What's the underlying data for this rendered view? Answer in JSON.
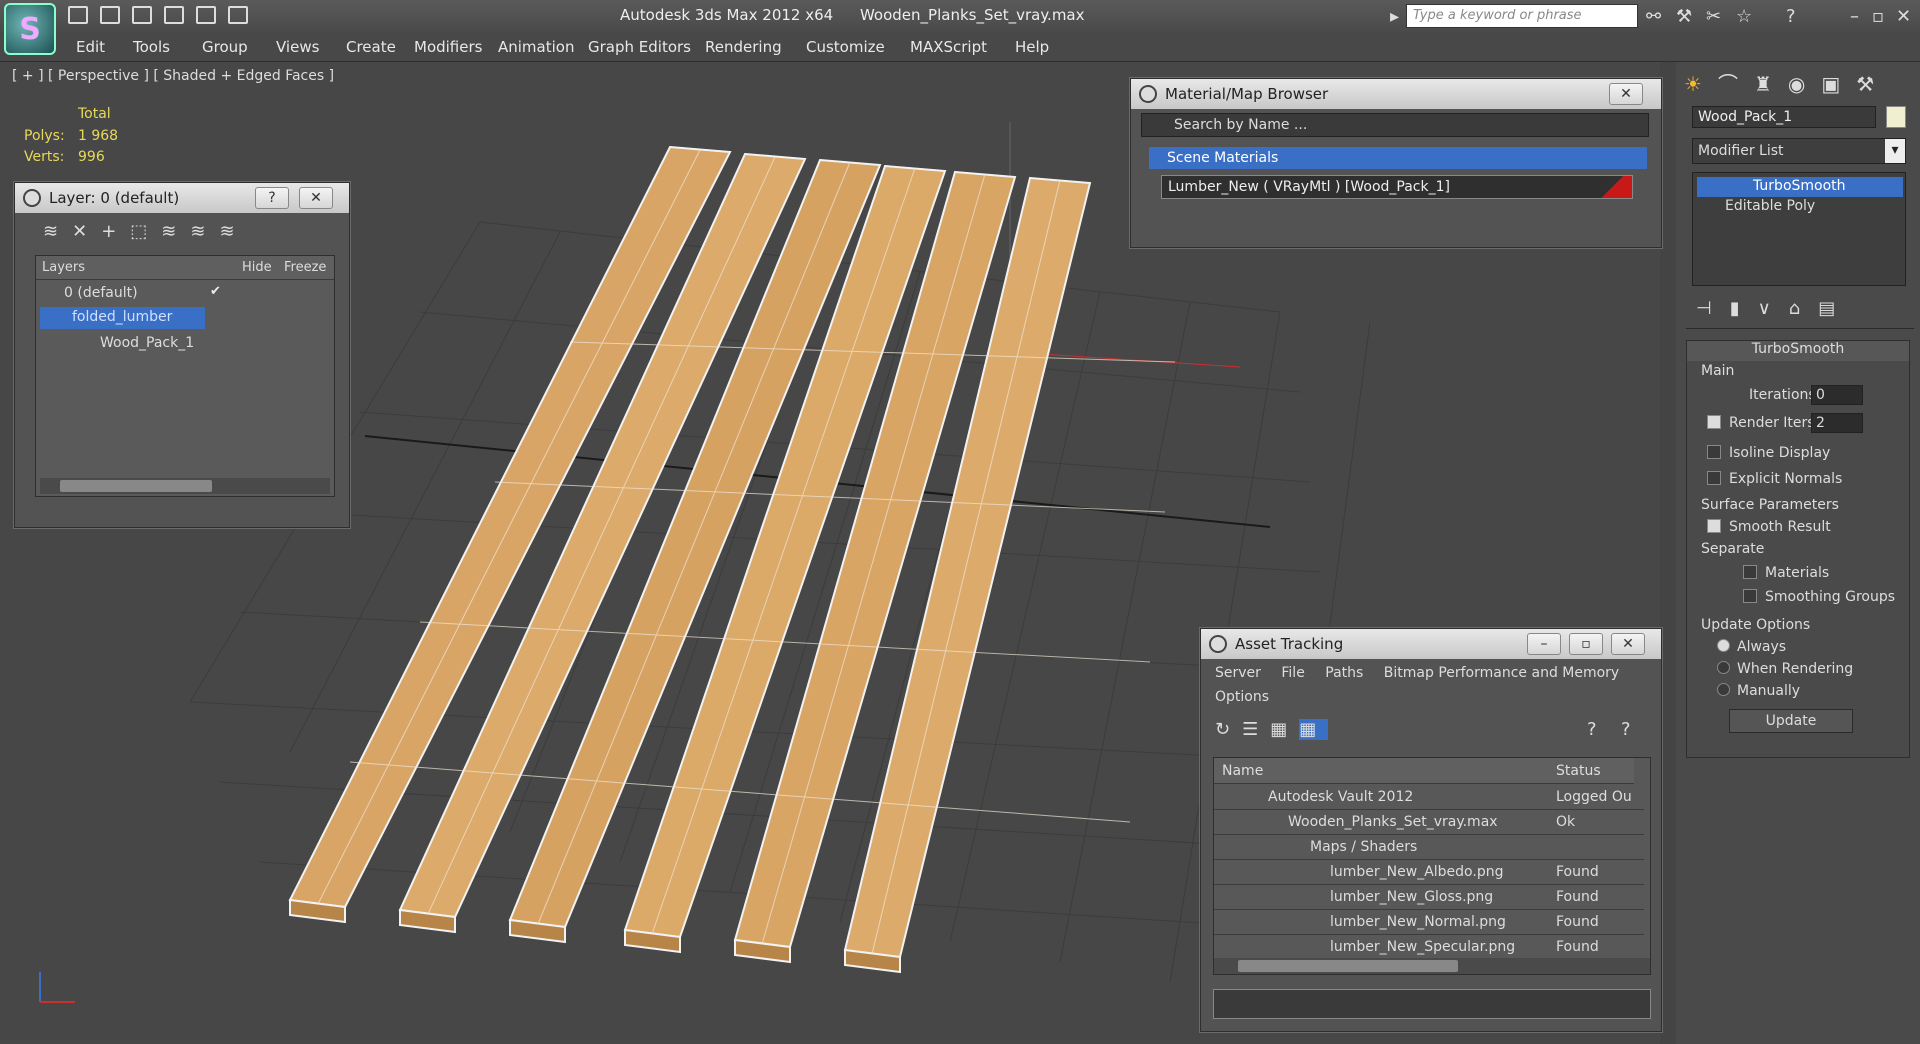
{
  "window": {
    "app_title": "Autodesk 3ds Max  2012 x64",
    "file_title": "Wooden_Planks_Set_vray.max",
    "search_placeholder": "Type a keyword or phrase"
  },
  "menu": [
    "Edit",
    "Tools",
    "Group",
    "Views",
    "Create",
    "Modifiers",
    "Animation",
    "Graph Editors",
    "Rendering",
    "Customize",
    "MAXScript",
    "Help"
  ],
  "viewport": {
    "label": "[ + ] [ Perspective ] [ Shaded + Edged Faces ]",
    "stats": {
      "total_label": "Total",
      "polys_label": "Polys:",
      "polys_value": "1 968",
      "verts_label": "Verts:",
      "verts_value": "996"
    }
  },
  "layer_panel": {
    "title": "Layer: 0 (default)",
    "help": "?",
    "close": "✕",
    "columns": {
      "layers": "Layers",
      "hide": "Hide",
      "freeze": "Freeze"
    },
    "rows": [
      "0 (default)",
      "folded_lumber",
      "Wood_Pack_1"
    ]
  },
  "material_browser": {
    "title": "Material/Map Browser",
    "search": "Search by Name ...",
    "section": "Scene Materials",
    "item": "Lumber_New  ( VRayMtl )  [Wood_Pack_1]"
  },
  "command_panel": {
    "object_name": "Wood_Pack_1",
    "modifier_list": "Modifier List",
    "stack": [
      "TurboSmooth",
      "Editable Poly"
    ],
    "rollout_title": "TurboSmooth",
    "main_group": "Main",
    "iterations_label": "Iterations:",
    "iterations_value": "0",
    "render_iters_label": "Render Iters:",
    "render_iters_value": "2",
    "isoline": "Isoline Display",
    "explicit_normals": "Explicit Normals",
    "surface_group": "Surface Parameters",
    "smooth_result": "Smooth Result",
    "separate": "Separate",
    "materials": "Materials",
    "smoothing_groups": "Smoothing Groups",
    "update_group": "Update Options",
    "always": "Always",
    "when_rendering": "When Rendering",
    "manually": "Manually",
    "update_button": "Update"
  },
  "asset_tracking": {
    "title": "Asset Tracking",
    "menu": [
      "Server",
      "File",
      "Paths",
      "Bitmap Performance and Memory"
    ],
    "menu2": "Options",
    "columns": {
      "name": "Name",
      "status": "Status"
    },
    "rows": [
      {
        "name": "Autodesk Vault 2012",
        "status": "Logged Ou"
      },
      {
        "name": "Wooden_Planks_Set_vray.max",
        "status": "Ok"
      },
      {
        "name": "Maps / Shaders",
        "status": ""
      },
      {
        "name": "lumber_New_Albedo.png",
        "status": "Found"
      },
      {
        "name": "lumber_New_Gloss.png",
        "status": "Found"
      },
      {
        "name": "lumber_New_Normal.png",
        "status": "Found"
      },
      {
        "name": "lumber_New_Specular.png",
        "status": "Found"
      }
    ]
  },
  "colors": {
    "accent": "#3a6fc6",
    "plank": "#d9a566",
    "grid": "#3c3c3c"
  }
}
